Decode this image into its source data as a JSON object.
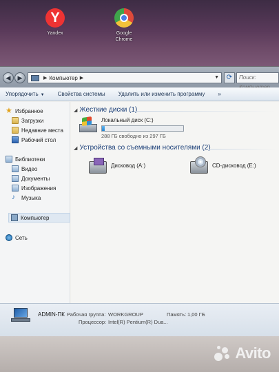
{
  "desktop": {
    "icons": [
      {
        "label": "Yandex"
      },
      {
        "label_line1": "Google",
        "label_line2": "Chrome"
      }
    ]
  },
  "navbar": {
    "breadcrumb": "Компьютер",
    "search_placeholder": "Поиск: Компьютер"
  },
  "toolbar": {
    "organize": "Упорядочить",
    "system_props": "Свойства системы",
    "uninstall": "Удалить или изменить программу",
    "more": "»"
  },
  "sidebar": {
    "favorites": "Избранное",
    "downloads": "Загрузки",
    "recent": "Недавние места",
    "desktop": "Рабочий стол",
    "libraries": "Библиотеки",
    "videos": "Видео",
    "documents": "Документы",
    "images": "Изображения",
    "music": "Музыка",
    "computer": "Компьютер",
    "network": "Сеть"
  },
  "content": {
    "hdd_group": "Жесткие диски (1)",
    "local_disk": {
      "name": "Локальный диск (C:)",
      "free_text": "288 ГБ свободно из 297 ГБ",
      "used_fraction": 0.03
    },
    "removable_group": "Устройства со съемными носителями (2)",
    "floppy": "Дисковод (A:)",
    "cd": "CD-дисковод (E:)"
  },
  "details": {
    "pc_name": "ADMIN-ПК",
    "workgroup_label": "Рабочая группа:",
    "workgroup_value": "WORKGROUP",
    "memory_label": "Память:",
    "memory_value": "1,00 ГБ",
    "cpu_label": "Процессор:",
    "cpu_value": "Intel(R) Pentium(R) Dua..."
  },
  "watermark": "Avito"
}
